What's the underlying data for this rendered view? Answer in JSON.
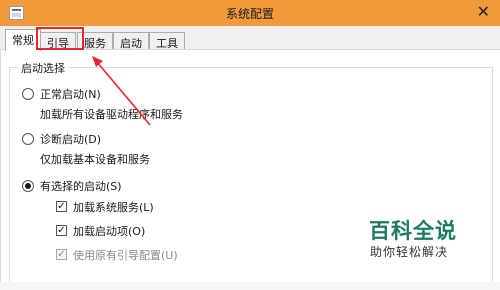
{
  "window": {
    "title": "系统配置",
    "close_glyph": "✕"
  },
  "tabs": [
    {
      "label": "常规",
      "active": true
    },
    {
      "label": "引导",
      "active": false,
      "highlighted": true
    },
    {
      "label": "服务",
      "active": false
    },
    {
      "label": "启动",
      "active": false
    },
    {
      "label": "工具",
      "active": false
    }
  ],
  "startup_group": {
    "legend": "启动选择",
    "options": [
      {
        "label": "正常启动(N)",
        "description": "加载所有设备驱动程序和服务",
        "selected": false
      },
      {
        "label": "诊断启动(D)",
        "description": "仅加载基本设备和服务",
        "selected": false
      },
      {
        "label": "有选择的启动(S)",
        "selected": true
      }
    ],
    "checkboxes": [
      {
        "label": "加载系统服务(L)",
        "checked": true,
        "disabled": false
      },
      {
        "label": "加载启动项(O)",
        "checked": true,
        "disabled": false
      },
      {
        "label": "使用原有引导配置(U)",
        "checked": true,
        "disabled": true
      }
    ]
  },
  "watermark": {
    "title": "百科全说",
    "subtitle": "助你轻松解决"
  },
  "colors": {
    "titlebar": "#f19a3b",
    "highlight": "#e8262b",
    "watermark": "#1c7a62"
  }
}
